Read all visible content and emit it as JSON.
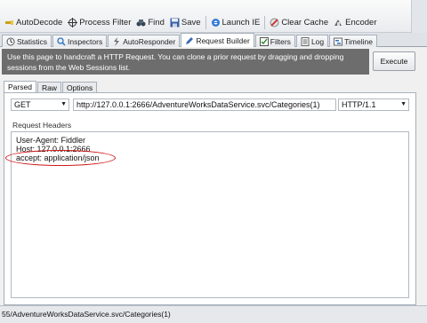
{
  "toolbar": {
    "buttons": [
      {
        "label": "AutoDecode",
        "icon": "wand-icon"
      },
      {
        "label": "Process Filter",
        "icon": "crosshair-icon"
      },
      {
        "label": "Find",
        "icon": "binoculars-icon"
      },
      {
        "label": "Save",
        "icon": "floppy-icon"
      },
      {
        "label": "Launch IE",
        "icon": "ie-icon"
      },
      {
        "label": "Clear Cache",
        "icon": "clear-cache-icon"
      },
      {
        "label": "Encoder",
        "icon": "encoder-icon"
      }
    ]
  },
  "tabs": [
    {
      "label": "Statistics",
      "icon": "clock-icon"
    },
    {
      "label": "Inspectors",
      "icon": "inspector-icon"
    },
    {
      "label": "AutoResponder",
      "icon": "lightning-icon"
    },
    {
      "label": "Request Builder",
      "icon": "pen-icon",
      "active": true
    },
    {
      "label": "Filters",
      "icon": "checkbox-icon"
    },
    {
      "label": "Log",
      "icon": "log-icon"
    },
    {
      "label": "Timeline",
      "icon": "timeline-icon"
    }
  ],
  "infobar": {
    "text": "Use this page to handcraft a HTTP Request. You can clone a prior request by dragging and dropping sessions from the Web Sessions list."
  },
  "execute_label": "Execute",
  "subtabs": [
    "Parsed",
    "Raw",
    "Options"
  ],
  "request": {
    "method": "GET",
    "url": "http://127.0.0.1:2666/AdventureWorksDataService.svc/Categories(1)",
    "version": "HTTP/1.1",
    "headers_label": "Request Headers",
    "headers": [
      "User-Agent: Fiddler",
      "Host: 127.0.0.1:2666",
      "accept: application/json"
    ]
  },
  "status": {
    "text": "55/AdventureWorksDataService.svc/Categories(1)"
  },
  "colors": {
    "infobar_bg": "#6d6d6d",
    "highlight": "#d01818"
  }
}
